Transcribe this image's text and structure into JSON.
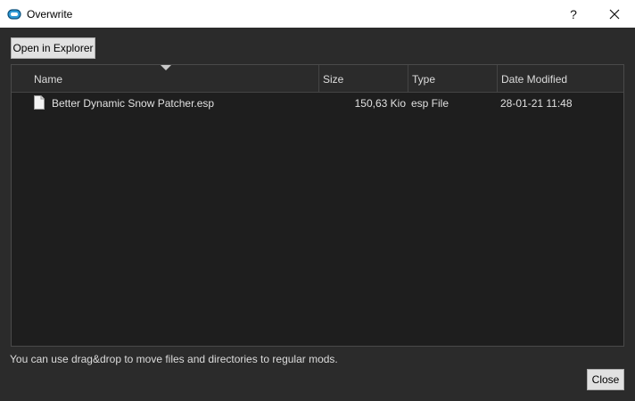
{
  "window": {
    "title": "Overwrite",
    "help_label": "?",
    "close_glyph": "✕",
    "app_icon": "mod-organizer-icon"
  },
  "toolbar": {
    "open_explorer_label": "Open in Explorer"
  },
  "table": {
    "columns": [
      "Name",
      "Size",
      "Type",
      "Date Modified"
    ],
    "sort_column": "Name",
    "sort_direction": "descending",
    "rows": [
      {
        "icon": "file-icon",
        "name": "Better Dynamic Snow Patcher.esp",
        "size": "150,63 Kio",
        "type": "esp File",
        "date_modified": "28-01-21 11:48"
      }
    ]
  },
  "footer": {
    "hint": "You can use drag&drop to move files and directories to regular mods.",
    "close_label": "Close"
  },
  "colors": {
    "background": "#2b2b2b",
    "tree_background": "#1e1e1e",
    "titlebar": "#ffffff",
    "button": "#e1e1e1"
  }
}
